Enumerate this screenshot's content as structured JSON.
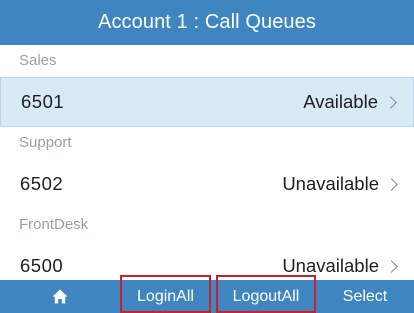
{
  "header": {
    "title": "Account 1 : Call Queues"
  },
  "queues": [
    {
      "group": "Sales",
      "number": "6501",
      "status": "Available",
      "selected": true
    },
    {
      "group": "Support",
      "number": "6502",
      "status": "Unavailable",
      "selected": false
    },
    {
      "group": "FrontDesk",
      "number": "6500",
      "status": "Unavailable",
      "selected": false
    }
  ],
  "softkeys": {
    "home_icon": "home-icon",
    "login_all": "LoginAll",
    "logout_all": "LogoutAll",
    "select": "Select"
  },
  "colors": {
    "accent": "#3f86c1",
    "selected_row": "#d9eaf7",
    "highlight": "#c8202f"
  }
}
